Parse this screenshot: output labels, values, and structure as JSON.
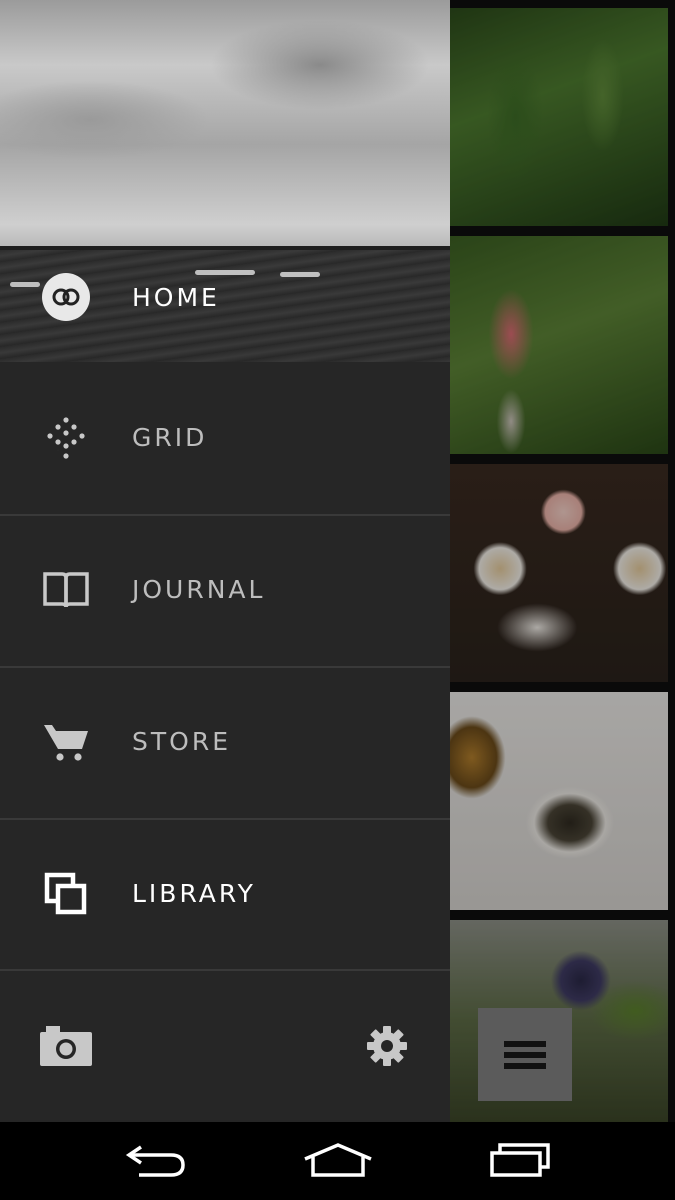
{
  "drawer": {
    "home_label": "HOME",
    "items": [
      {
        "label": "GRID",
        "icon": "grid-dots-icon"
      },
      {
        "label": "JOURNAL",
        "icon": "book-icon"
      },
      {
        "label": "STORE",
        "icon": "cart-icon"
      },
      {
        "label": "LIBRARY",
        "icon": "library-icon"
      }
    ],
    "bottom": {
      "camera_icon": "camera-icon",
      "settings_icon": "gear-icon"
    }
  },
  "colors": {
    "drawer_bg": "#262626",
    "divider": "#393939",
    "label_inactive": "#bdbdbd",
    "label_active": "#ffffff",
    "fab_bg": "#5b5b5b"
  },
  "system_nav": {
    "back_icon": "back-arrow-icon",
    "home_icon": "home-icon",
    "recents_icon": "recents-icon"
  }
}
